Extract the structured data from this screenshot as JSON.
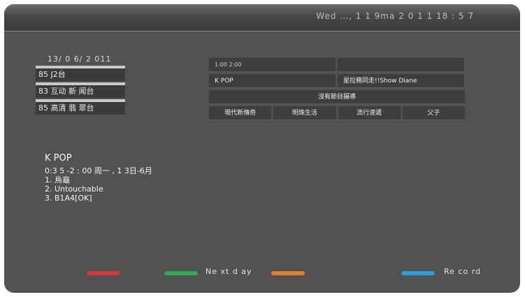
{
  "header": {
    "status_text": "Wed  …, 1 1  9ma  2 0 1 1  18 : 5 7"
  },
  "epg": {
    "date": "13/ 0 6/ 2 011",
    "channels": [
      {
        "label": "85  J2台"
      },
      {
        "label": "83  互动 新 闻台"
      },
      {
        "label": "85  高清 翡 翠台"
      }
    ],
    "grid": {
      "time_cell": "1:00 2:00",
      "empty_cell": "",
      "program_a": "K    POP",
      "program_b": "星拉務同走!!Show   Diane",
      "no_info": "沒有節目摄導",
      "bottom_row": [
        "現代新傳奇",
        "明珠生活",
        "流行速遞",
        "父子"
      ]
    }
  },
  "program_detail": {
    "title": "K POP",
    "time_line": "0:3 5 -2 : 00 周一 , 1 3日-6月",
    "items": [
      "1. 烏龜",
      "2. Untouchable",
      "3. B1A4[OK]"
    ]
  },
  "legend": {
    "keys": [
      {
        "color": "#d13a3a",
        "label": ""
      },
      {
        "color": "#2fa858",
        "label": "Ne xt d ay"
      },
      {
        "color": "#e07f2a",
        "label": ""
      },
      {
        "color": "#2a9ed8",
        "label": "Re co rd"
      }
    ]
  }
}
